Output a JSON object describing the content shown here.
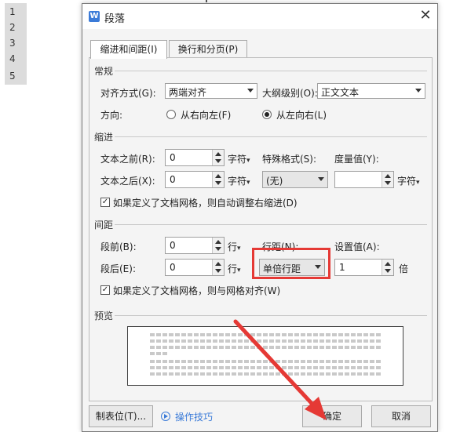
{
  "line_numbers": [
    "1",
    "2",
    "3",
    "4",
    "5"
  ],
  "dialog": {
    "title": "段落",
    "close_glyph": "✕",
    "app_icon_letter": "W",
    "tabs": [
      {
        "label": "缩进和间距(I)",
        "active": true
      },
      {
        "label": "换行和分页(P)",
        "active": false
      }
    ],
    "general": {
      "section": "常规",
      "alignment_label": "对齐方式(G):",
      "alignment_value": "两端对齐",
      "outline_label": "大纲级别(O):",
      "outline_value": "正文文本",
      "direction_label": "方向:",
      "rtl_label": "从右向左(F)",
      "ltr_label": "从左向右(L)",
      "direction_selected": "ltr"
    },
    "indent": {
      "section": "缩进",
      "before_label": "文本之前(R):",
      "before_value": "0",
      "before_unit": "字符",
      "after_label": "文本之后(X):",
      "after_value": "0",
      "after_unit": "字符",
      "special_label": "特殊格式(S):",
      "special_value": "(无)",
      "measure_label": "度量值(Y):",
      "measure_value": "",
      "measure_unit": "字符",
      "auto_adjust_checked": true,
      "auto_adjust_label": "如果定义了文档网格，则自动调整右缩进(D)"
    },
    "spacing": {
      "section": "间距",
      "before_label": "段前(B):",
      "before_value": "0",
      "before_unit": "行",
      "after_label": "段后(E):",
      "after_value": "0",
      "after_unit": "行",
      "line_spacing_label": "行距(N):",
      "line_spacing_value": "单倍行距",
      "setting_label": "设置值(A):",
      "setting_value": "1",
      "setting_unit": "倍",
      "snap_grid_checked": true,
      "snap_grid_label": "如果定义了文档网格，则与网格对齐(W)"
    },
    "preview": {
      "section": "预览"
    },
    "footer": {
      "tabs_button": "制表位(T)...",
      "tips_label": "操作技巧",
      "ok_button": "确定",
      "cancel_button": "取消"
    }
  },
  "colors": {
    "annotation_red": "#e53935",
    "accent_blue": "#3b7bd8"
  }
}
